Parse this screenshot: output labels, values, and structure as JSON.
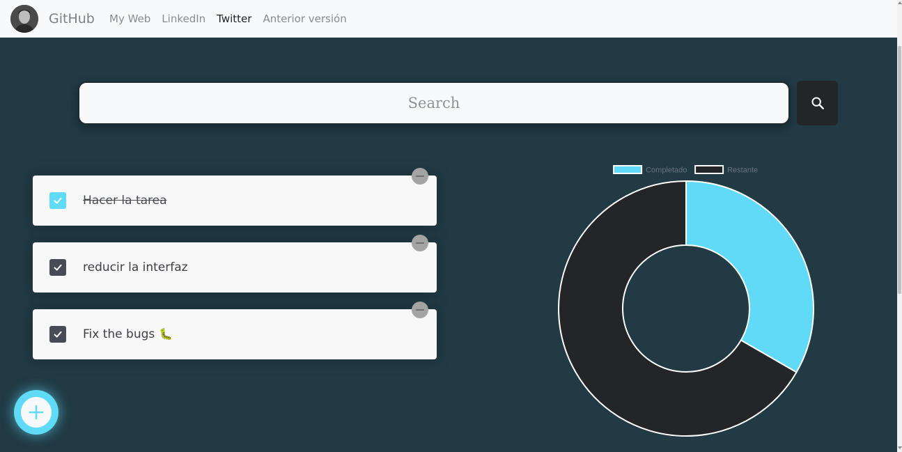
{
  "nav": {
    "brand": "GitHub",
    "links": [
      {
        "label": "My Web",
        "active": false
      },
      {
        "label": "LinkedIn",
        "active": false
      },
      {
        "label": "Twitter",
        "active": true
      },
      {
        "label": "Anterior versión",
        "active": false
      }
    ]
  },
  "search": {
    "placeholder": "Search",
    "value": "",
    "icon": "search-icon"
  },
  "todos": [
    {
      "text": "Hacer la tarea",
      "completed": true,
      "emoji": ""
    },
    {
      "text": "reducir la interfaz",
      "completed": false,
      "emoji": ""
    },
    {
      "text": "Fix the bugs",
      "completed": false,
      "emoji": "🐛"
    }
  ],
  "fab": {
    "icon": "plus-icon"
  },
  "colors": {
    "background": "#213a44",
    "accent": "#61daf8",
    "dark": "#232529"
  },
  "chart_data": {
    "type": "pie",
    "variant": "doughnut",
    "legend_position": "top",
    "series": [
      {
        "name": "Completado",
        "value": 1,
        "color": "#61daf8"
      },
      {
        "name": "Restante",
        "value": 2,
        "color": "#232529"
      }
    ]
  }
}
